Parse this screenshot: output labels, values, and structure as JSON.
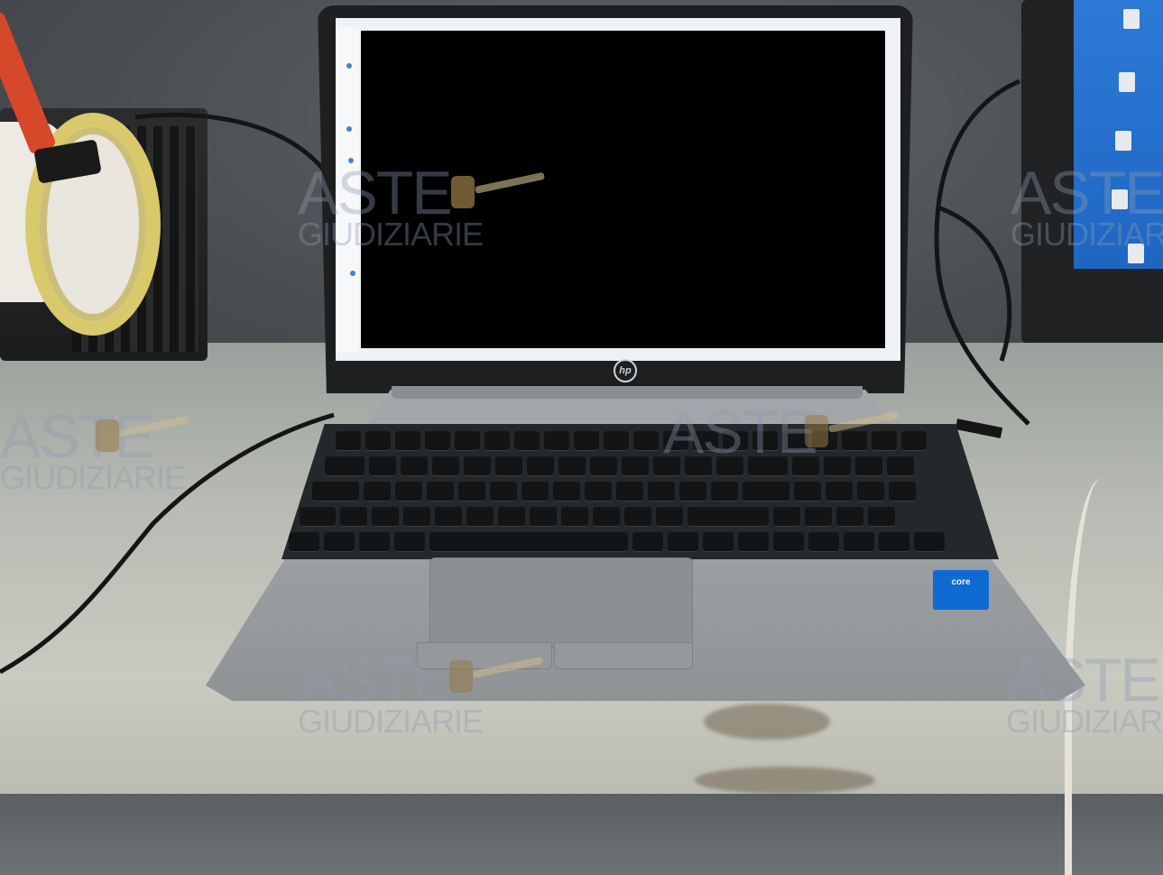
{
  "photo": {
    "laptop_brand": "hp",
    "processor_badge": "core",
    "screen_state": "redacted",
    "colors": {
      "desk": "#c9cac0",
      "laptop_body": "#a3a7aa",
      "screen_mask": "#000000",
      "badge": "#0f6ad2"
    }
  },
  "watermark": {
    "line1": "ASTE",
    "line2": "GIUDIZIARIE",
    "icon": "gavel-icon"
  }
}
